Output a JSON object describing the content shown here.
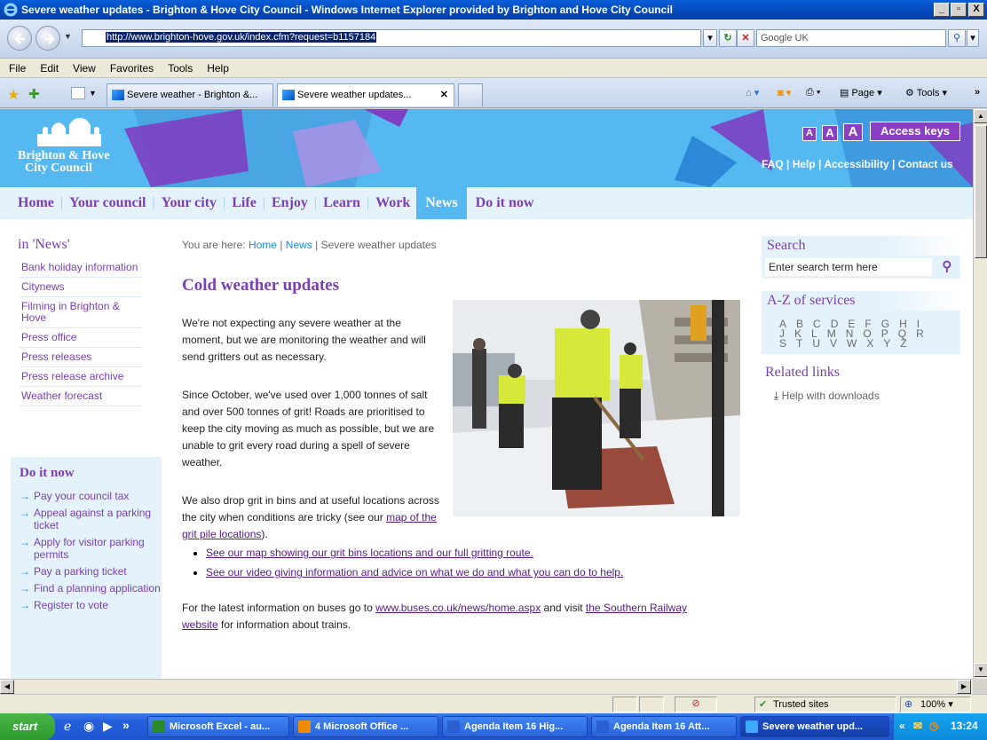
{
  "window": {
    "title": "Severe weather updates - Brighton & Hove City Council - Windows Internet Explorer provided by Brighton and Hove City Council"
  },
  "addressbar": {
    "url": "http://www.brighton-hove.gov.uk/index.cfm?request=b1157184",
    "search_placeholder": "Google UK"
  },
  "menu": [
    "File",
    "Edit",
    "View",
    "Favorites",
    "Tools",
    "Help"
  ],
  "tabs": [
    {
      "label": "Severe weather - Brighton &..."
    },
    {
      "label": "Severe weather updates..."
    }
  ],
  "toolbar_right": {
    "page": "Page",
    "tools": "Tools"
  },
  "site": {
    "logo_line1": "Brighton & Hove",
    "logo_line2": "City Council",
    "access": {
      "a1": "A",
      "a2": "A",
      "a3": "A",
      "keys": "Access keys"
    },
    "toplinks": [
      "FAQ",
      "Help",
      "Accessibility",
      "Contact us"
    ],
    "nav": [
      "Home",
      "Your council",
      "Your city",
      "Life",
      "Enjoy",
      "Learn",
      "Work",
      "News",
      "Do it now"
    ],
    "nav_active": "News"
  },
  "left": {
    "section_title": "in 'News'",
    "links": [
      "Bank holiday information",
      "Citynews",
      "Filming in Brighton & Hove",
      "Press office",
      "Press releases",
      "Press release archive",
      "Weather forecast"
    ],
    "doitnow_title": "Do it now",
    "doitnow": [
      "Pay your council tax",
      "Appeal against a parking ticket",
      "Apply for visitor parking permits",
      "Pay a parking ticket",
      "Find a planning application",
      "Register to vote"
    ]
  },
  "main": {
    "breadcrumb": {
      "prefix": "You are here:",
      "home": "Home",
      "news": "News",
      "current": "Severe weather updates"
    },
    "title": "Cold weather updates",
    "p1": "We're not expecting any severe weather at the moment, but we are monitoring the weather and will send gritters out as necessary.",
    "p2": "Since October, we've used over 1,000 tonnes of salt and over 500 tonnes of grit! Roads are prioritised to keep the city moving as much as possible, but we are unable to grit every road during a spell of severe weather.",
    "p3_start": "We also drop grit in bins and at useful locations across the city when conditions are tricky (see our ",
    "p3_link": "map of the grit pile locations",
    "p3_end": ").",
    "bullets": [
      "See our map showing our grit bins locations and our full gritting route.",
      "See our video giving information and advice on what we do and what you can do to help."
    ],
    "p4_start": "For the latest information on buses go to ",
    "p4_link1": "www.buses.co.uk/news/home.aspx",
    "p4_mid": " and visit ",
    "p4_link2": "the Southern Railway website",
    "p4_end": " for information about trains."
  },
  "right": {
    "search_title": "Search",
    "search_placeholder": "Enter search term here",
    "az_title": "A-Z of services",
    "az_rows": [
      [
        "A",
        "B",
        "C",
        "D",
        "E",
        "F",
        "G",
        "H",
        "I"
      ],
      [
        "J",
        "K",
        "L",
        "M",
        "N",
        "O",
        "P",
        "Q",
        "R"
      ],
      [
        "S",
        "T",
        "U",
        "V",
        "W",
        "X",
        "Y",
        "Z"
      ]
    ],
    "related_title": "Related links",
    "related": [
      "Help with downloads"
    ]
  },
  "status": {
    "zone": "Trusted sites",
    "zoom": "100%"
  },
  "taskbar": {
    "start": "start",
    "tasks": [
      "Microsoft Excel - au...",
      "4 Microsoft Office ...",
      "Agenda Item 16 Hig...",
      "Agenda Item 16 Att...",
      "Severe weather upd..."
    ],
    "clock": "13:24"
  },
  "colors": {
    "brand_purple": "#7a3fb0",
    "banner_blue": "#55b8f0",
    "link_blue": "#1f8ad6"
  }
}
